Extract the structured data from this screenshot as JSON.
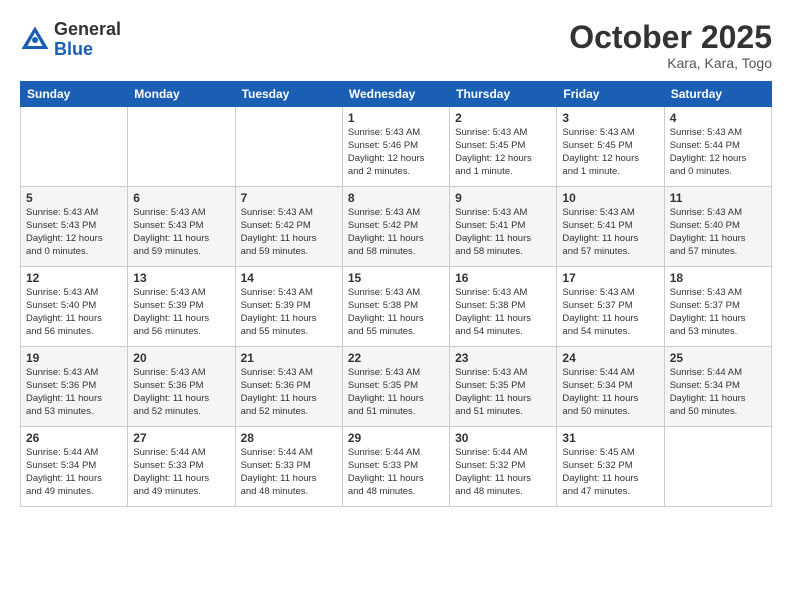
{
  "logo": {
    "general": "General",
    "blue": "Blue"
  },
  "header": {
    "month": "October 2025",
    "location": "Kara, Kara, Togo"
  },
  "weekdays": [
    "Sunday",
    "Monday",
    "Tuesday",
    "Wednesday",
    "Thursday",
    "Friday",
    "Saturday"
  ],
  "weeks": [
    [
      {
        "day": "",
        "info": ""
      },
      {
        "day": "",
        "info": ""
      },
      {
        "day": "",
        "info": ""
      },
      {
        "day": "1",
        "info": "Sunrise: 5:43 AM\nSunset: 5:46 PM\nDaylight: 12 hours\nand 2 minutes."
      },
      {
        "day": "2",
        "info": "Sunrise: 5:43 AM\nSunset: 5:45 PM\nDaylight: 12 hours\nand 1 minute."
      },
      {
        "day": "3",
        "info": "Sunrise: 5:43 AM\nSunset: 5:45 PM\nDaylight: 12 hours\nand 1 minute."
      },
      {
        "day": "4",
        "info": "Sunrise: 5:43 AM\nSunset: 5:44 PM\nDaylight: 12 hours\nand 0 minutes."
      }
    ],
    [
      {
        "day": "5",
        "info": "Sunrise: 5:43 AM\nSunset: 5:43 PM\nDaylight: 12 hours\nand 0 minutes."
      },
      {
        "day": "6",
        "info": "Sunrise: 5:43 AM\nSunset: 5:43 PM\nDaylight: 11 hours\nand 59 minutes."
      },
      {
        "day": "7",
        "info": "Sunrise: 5:43 AM\nSunset: 5:42 PM\nDaylight: 11 hours\nand 59 minutes."
      },
      {
        "day": "8",
        "info": "Sunrise: 5:43 AM\nSunset: 5:42 PM\nDaylight: 11 hours\nand 58 minutes."
      },
      {
        "day": "9",
        "info": "Sunrise: 5:43 AM\nSunset: 5:41 PM\nDaylight: 11 hours\nand 58 minutes."
      },
      {
        "day": "10",
        "info": "Sunrise: 5:43 AM\nSunset: 5:41 PM\nDaylight: 11 hours\nand 57 minutes."
      },
      {
        "day": "11",
        "info": "Sunrise: 5:43 AM\nSunset: 5:40 PM\nDaylight: 11 hours\nand 57 minutes."
      }
    ],
    [
      {
        "day": "12",
        "info": "Sunrise: 5:43 AM\nSunset: 5:40 PM\nDaylight: 11 hours\nand 56 minutes."
      },
      {
        "day": "13",
        "info": "Sunrise: 5:43 AM\nSunset: 5:39 PM\nDaylight: 11 hours\nand 56 minutes."
      },
      {
        "day": "14",
        "info": "Sunrise: 5:43 AM\nSunset: 5:39 PM\nDaylight: 11 hours\nand 55 minutes."
      },
      {
        "day": "15",
        "info": "Sunrise: 5:43 AM\nSunset: 5:38 PM\nDaylight: 11 hours\nand 55 minutes."
      },
      {
        "day": "16",
        "info": "Sunrise: 5:43 AM\nSunset: 5:38 PM\nDaylight: 11 hours\nand 54 minutes."
      },
      {
        "day": "17",
        "info": "Sunrise: 5:43 AM\nSunset: 5:37 PM\nDaylight: 11 hours\nand 54 minutes."
      },
      {
        "day": "18",
        "info": "Sunrise: 5:43 AM\nSunset: 5:37 PM\nDaylight: 11 hours\nand 53 minutes."
      }
    ],
    [
      {
        "day": "19",
        "info": "Sunrise: 5:43 AM\nSunset: 5:36 PM\nDaylight: 11 hours\nand 53 minutes."
      },
      {
        "day": "20",
        "info": "Sunrise: 5:43 AM\nSunset: 5:36 PM\nDaylight: 11 hours\nand 52 minutes."
      },
      {
        "day": "21",
        "info": "Sunrise: 5:43 AM\nSunset: 5:36 PM\nDaylight: 11 hours\nand 52 minutes."
      },
      {
        "day": "22",
        "info": "Sunrise: 5:43 AM\nSunset: 5:35 PM\nDaylight: 11 hours\nand 51 minutes."
      },
      {
        "day": "23",
        "info": "Sunrise: 5:43 AM\nSunset: 5:35 PM\nDaylight: 11 hours\nand 51 minutes."
      },
      {
        "day": "24",
        "info": "Sunrise: 5:44 AM\nSunset: 5:34 PM\nDaylight: 11 hours\nand 50 minutes."
      },
      {
        "day": "25",
        "info": "Sunrise: 5:44 AM\nSunset: 5:34 PM\nDaylight: 11 hours\nand 50 minutes."
      }
    ],
    [
      {
        "day": "26",
        "info": "Sunrise: 5:44 AM\nSunset: 5:34 PM\nDaylight: 11 hours\nand 49 minutes."
      },
      {
        "day": "27",
        "info": "Sunrise: 5:44 AM\nSunset: 5:33 PM\nDaylight: 11 hours\nand 49 minutes."
      },
      {
        "day": "28",
        "info": "Sunrise: 5:44 AM\nSunset: 5:33 PM\nDaylight: 11 hours\nand 48 minutes."
      },
      {
        "day": "29",
        "info": "Sunrise: 5:44 AM\nSunset: 5:33 PM\nDaylight: 11 hours\nand 48 minutes."
      },
      {
        "day": "30",
        "info": "Sunrise: 5:44 AM\nSunset: 5:32 PM\nDaylight: 11 hours\nand 48 minutes."
      },
      {
        "day": "31",
        "info": "Sunrise: 5:45 AM\nSunset: 5:32 PM\nDaylight: 11 hours\nand 47 minutes."
      },
      {
        "day": "",
        "info": ""
      }
    ]
  ]
}
